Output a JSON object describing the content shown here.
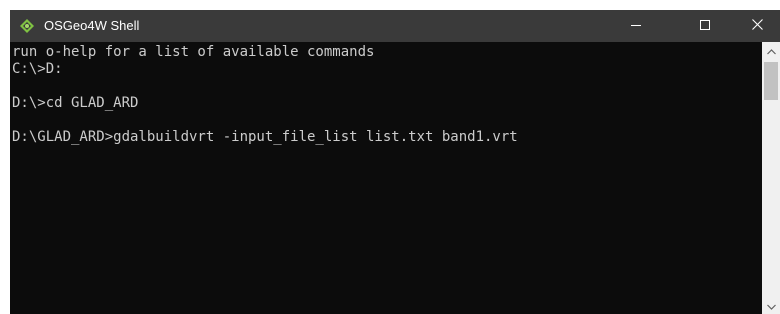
{
  "window": {
    "title": "OSGeo4W Shell"
  },
  "console": {
    "lines": [
      "run o-help for a list of available commands",
      "C:\\>D:",
      "",
      "D:\\>cd GLAD_ARD",
      "",
      "D:\\GLAD_ARD>gdalbuildvrt -input_file_list list.txt band1.vrt"
    ]
  },
  "icons": {
    "app": "osgeo-icon",
    "minimize": "minimize-icon",
    "maximize": "maximize-icon",
    "close": "close-icon",
    "scroll_up": "chevron-up-icon",
    "scroll_down": "chevron-down-icon"
  },
  "colors": {
    "titlebar": "#3a3a3a",
    "console_background": "#0c0c0c",
    "console_text": "#cccccc",
    "scrollbar_track": "#f0f0f0",
    "scrollbar_thumb": "#c2c2c2"
  }
}
